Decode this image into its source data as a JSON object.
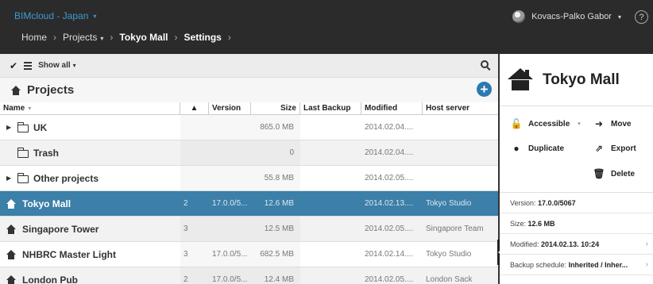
{
  "header": {
    "app_title": "BIMcloud - Japan",
    "breadcrumbs": [
      {
        "label": "Home"
      },
      {
        "label": "Projects"
      },
      {
        "label": "Tokyo Mall"
      },
      {
        "label": "Settings"
      }
    ],
    "user_name": "Kovacs-Palko Gabor",
    "help_label": "?"
  },
  "toolbar": {
    "filter_label": "Show all"
  },
  "projects": {
    "title": "Projects",
    "columns": [
      "Name",
      "Version",
      "Size",
      "Last Backup",
      "Modified",
      "Host server"
    ],
    "rows": [
      {
        "name": "UK",
        "kind": "folder",
        "expandable": true,
        "users": "",
        "version": "",
        "size": "865.0 MB",
        "backup": "",
        "modified": "2014.02.04....",
        "host": ""
      },
      {
        "name": "Trash",
        "kind": "folder",
        "expandable": false,
        "users": "",
        "version": "",
        "size": "0",
        "backup": "",
        "modified": "2014.02.04....",
        "host": ""
      },
      {
        "name": "Other projects",
        "kind": "folder",
        "expandable": true,
        "users": "",
        "version": "",
        "size": "55.8 MB",
        "backup": "",
        "modified": "2014.02.05....",
        "host": ""
      },
      {
        "name": "Tokyo Mall",
        "kind": "project",
        "selected": true,
        "users": "2",
        "version": "17.0.0/5...",
        "size": "12.6 MB",
        "backup": "",
        "modified": "2014.02.13....",
        "host": "Tokyo Studio"
      },
      {
        "name": "Singapore Tower",
        "kind": "project",
        "users": "3",
        "version": "",
        "size": "12.5 MB",
        "backup": "",
        "modified": "2014.02.05....",
        "host": "Singapore Team"
      },
      {
        "name": "NHBRC Master Light",
        "kind": "project",
        "users": "3",
        "version": "17.0.0/5...",
        "size": "682.5 MB",
        "backup": "",
        "modified": "2014.02.14....",
        "host": "Tokyo Studio"
      },
      {
        "name": "London Pub",
        "kind": "project",
        "users": "2",
        "version": "17.0.0/5...",
        "size": "12.4 MB",
        "backup": "",
        "modified": "2014.02.05....",
        "host": "London Sack"
      }
    ]
  },
  "details": {
    "title": "Tokyo Mall",
    "actions": {
      "accessible": "Accessible",
      "move": "Move",
      "duplicate": "Duplicate",
      "export": "Export",
      "delete": "Delete"
    },
    "info": {
      "version_label": "Version:",
      "version_value": "17.0.0/5067",
      "size_label": "Size:",
      "size_value": "12.6 MB",
      "modified_label": "Modified:",
      "modified_value": "2014.02.13. 10:24",
      "backup_label": "Backup schedule:",
      "backup_value": "Inherited / Inher..."
    }
  }
}
